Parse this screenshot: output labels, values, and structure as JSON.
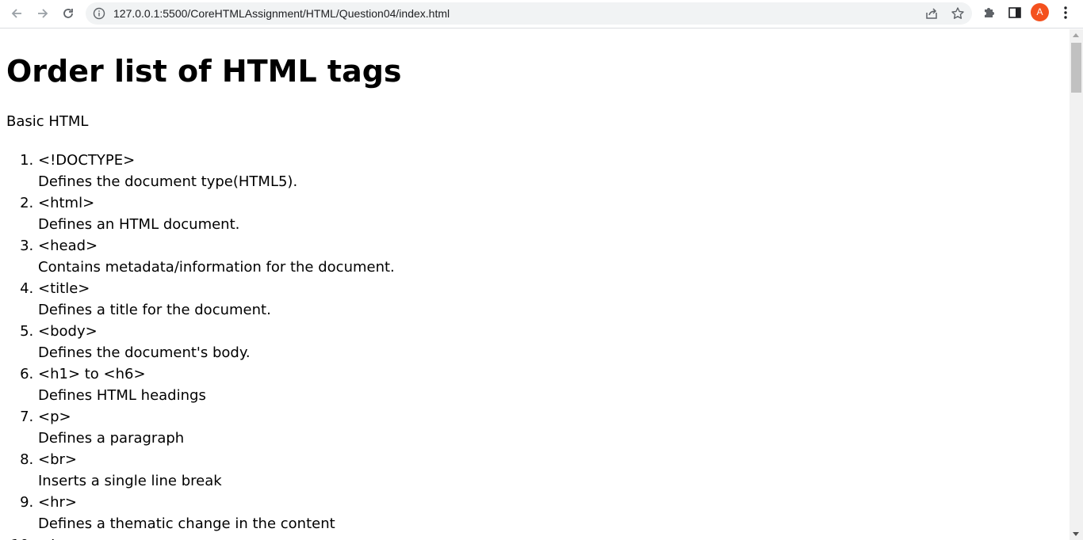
{
  "browser": {
    "url": "127.0.0.1:5500/CoreHTMLAssignment/HTML/Question04/index.html",
    "profile_initial": "A",
    "profile_color": "#f4511e"
  },
  "page": {
    "heading": "Order list of HTML tags",
    "subtitle": "Basic HTML",
    "items": [
      {
        "tag": "<!DOCTYPE>",
        "desc": "Defines the document type(HTML5)."
      },
      {
        "tag": "<html>",
        "desc": "Defines an HTML document."
      },
      {
        "tag": "<head>",
        "desc": "Contains metadata/information for the document."
      },
      {
        "tag": "<title>",
        "desc": "Defines a title for the document."
      },
      {
        "tag": "<body>",
        "desc": "Defines the document's body."
      },
      {
        "tag": "<h1> to <h6>",
        "desc": "Defines HTML headings"
      },
      {
        "tag": "<p>",
        "desc": "Defines a paragraph"
      },
      {
        "tag": "<br>",
        "desc": "Inserts a single line break"
      },
      {
        "tag": "<hr>",
        "desc": "Defines a thematic change in the content"
      },
      {
        "tag": "<!--...-->",
        "desc": ""
      }
    ]
  }
}
